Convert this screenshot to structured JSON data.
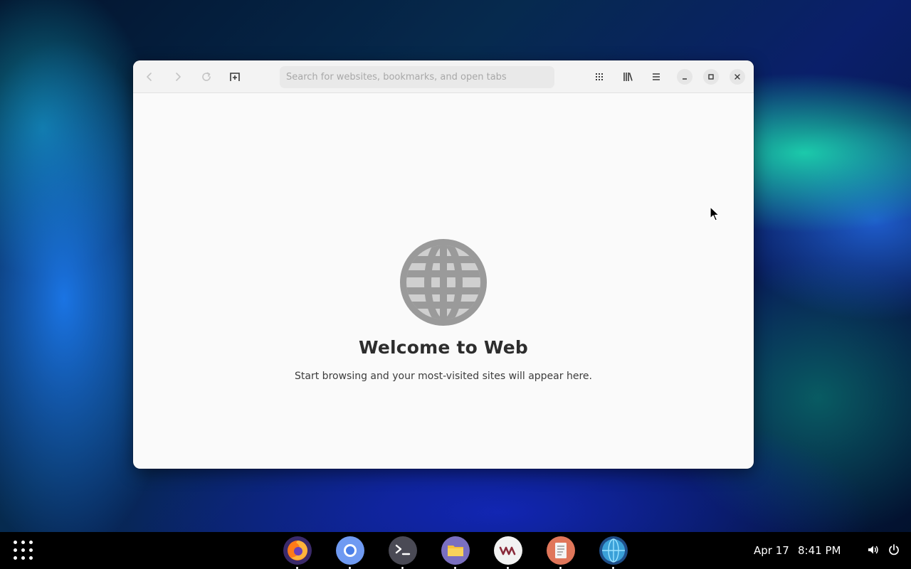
{
  "browser": {
    "url_placeholder": "Search for websites, bookmarks, and open tabs",
    "welcome_title": "Welcome to Web",
    "welcome_subtitle": "Start browsing and your most-visited sites will appear here.",
    "toolbar_icons": [
      "back-icon",
      "forward-icon",
      "reload-icon",
      "new-tab-icon",
      "tabs-overview-icon",
      "bookmarks-icon",
      "menu-icon",
      "minimize-icon",
      "maximize-icon",
      "close-icon"
    ]
  },
  "taskbar": {
    "dock": [
      {
        "name": "firefox",
        "icon": "firefox-icon"
      },
      {
        "name": "chromium",
        "icon": "chromium-icon"
      },
      {
        "name": "terminal",
        "icon": "terminal-icon"
      },
      {
        "name": "files",
        "icon": "files-icon"
      },
      {
        "name": "virt-manager",
        "icon": "vm-icon"
      },
      {
        "name": "text-editor",
        "icon": "text-editor-icon"
      },
      {
        "name": "web",
        "icon": "web-browser-icon"
      }
    ],
    "date": "Apr 17",
    "time": "8:41 PM"
  },
  "colors": {
    "window_bg": "#fafafa",
    "headerbar_bg": "#f3f3f3",
    "taskbar_bg": "#000000",
    "globe_gray": "#9a9a9a"
  }
}
